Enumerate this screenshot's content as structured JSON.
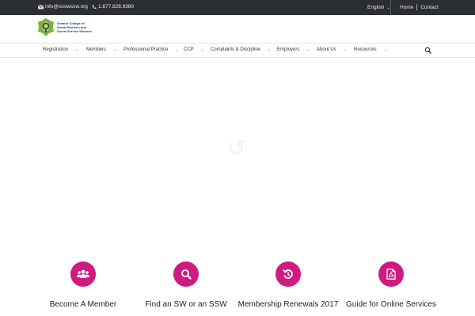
{
  "topbar": {
    "email": "info@ocswssw.org",
    "phone": "1.877.828.9380",
    "language": "English",
    "links": [
      "Home",
      "Contact"
    ]
  },
  "logo": {
    "lines": [
      "Ontario College of",
      "Social Workers and",
      "Social Service Workers"
    ]
  },
  "nav": {
    "items": [
      "Registration",
      "Members",
      "Professional Practice",
      "CCP",
      "Complaints & Discipline",
      "Employers",
      "About Us",
      "Resources"
    ]
  },
  "tiles": [
    {
      "label": "Become A Member",
      "icon": "members-icon"
    },
    {
      "label": "Find an SW or an SSW",
      "icon": "search-icon"
    },
    {
      "label": "Membership Renewals 2017",
      "icon": "renew-icon"
    },
    {
      "label": "Guide for Online Services",
      "icon": "pdf-icon"
    }
  ],
  "colors": {
    "topbar": "#2b2e33",
    "accent": "#d01a80",
    "logo_green": "#7cb342",
    "logo_navy": "#1a3b7a"
  }
}
